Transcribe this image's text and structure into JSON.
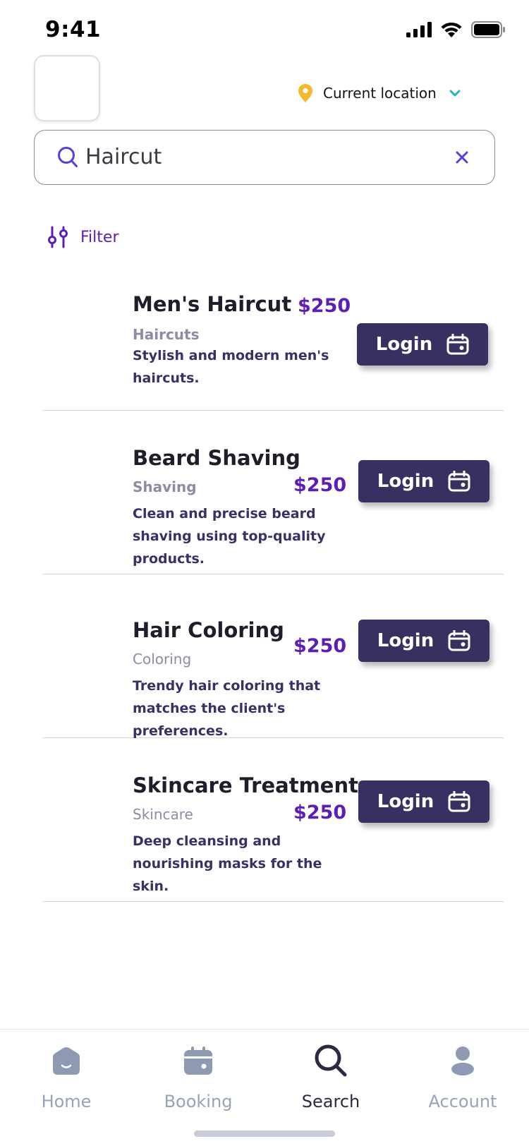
{
  "status_bar": {
    "time": "9:41"
  },
  "header": {
    "location_label": "Current location"
  },
  "search": {
    "value": "Haircut"
  },
  "filter": {
    "label": "Filter"
  },
  "colors": {
    "accent": "#5b1fb5",
    "button": "#383060",
    "location_pin": "#f5b82e",
    "chevron": "#1fb5c4"
  },
  "services": [
    {
      "title": "Men's Haircut",
      "category": "Haircuts",
      "price": "$250",
      "description": "Stylish and modern men's haircuts.",
      "button_label": "Login"
    },
    {
      "title": "Beard Shaving",
      "category": "Shaving",
      "price": "$250",
      "description": "Clean and precise beard shaving using top-quality products.",
      "button_label": "Login"
    },
    {
      "title": "Hair Coloring",
      "category": "Coloring",
      "price": "$250",
      "description": "Trendy hair coloring that matches the client's preferences.",
      "button_label": "Login"
    },
    {
      "title": "Skincare Treatment",
      "category": "Skincare",
      "price": "$250",
      "description": "Deep cleansing and nourishing masks for the skin.",
      "button_label": "Login"
    }
  ],
  "tabs": [
    {
      "label": "Home",
      "icon": "home-icon",
      "active": false
    },
    {
      "label": "Booking",
      "icon": "calendar-icon",
      "active": false
    },
    {
      "label": "Search",
      "icon": "search-icon",
      "active": true
    },
    {
      "label": "Account",
      "icon": "user-icon",
      "active": false
    }
  ]
}
